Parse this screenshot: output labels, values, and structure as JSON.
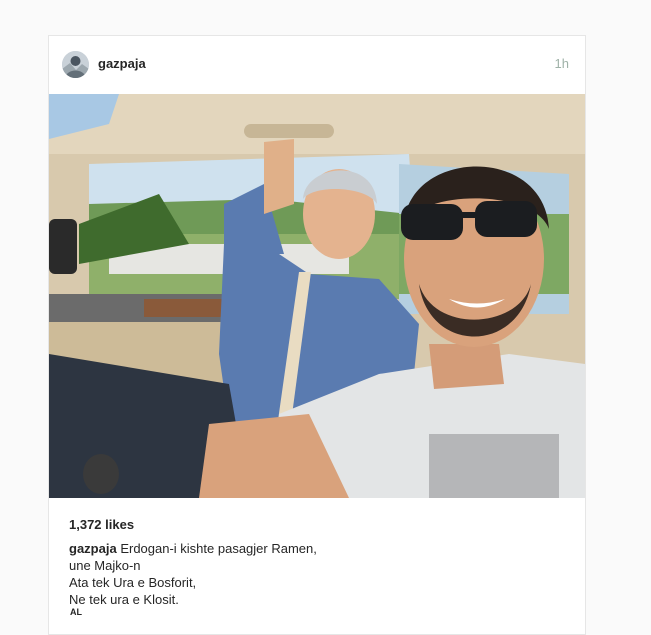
{
  "post": {
    "username": "gazpaja",
    "time": "1h",
    "likes": "1,372 likes",
    "caption_user": "gazpaja",
    "caption_lines": [
      "Erdogan-i kishte pasagjer Ramen,",
      "une Majko-n",
      "Ata tek Ura e Bosforit,",
      "Ne tek ura e Klosit."
    ],
    "language": "AL"
  },
  "colors": {
    "accent_text": "#262626",
    "time_text": "#9fb2a8",
    "card_border": "#e6e6e6",
    "page_background": "#fafafa"
  }
}
